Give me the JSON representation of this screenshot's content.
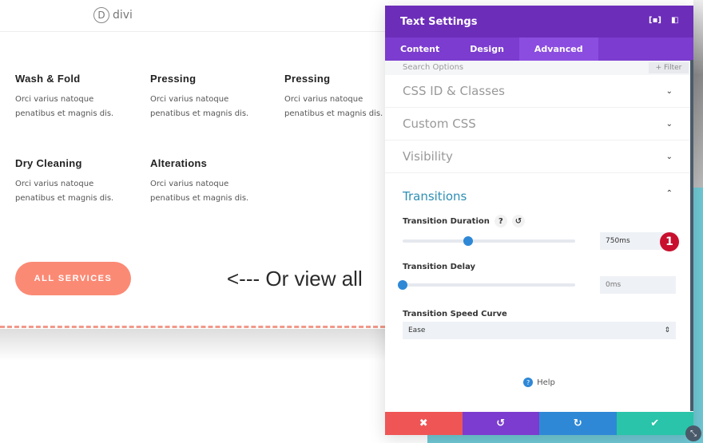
{
  "site": {
    "logo_letter": "D",
    "logo_text": "divi"
  },
  "services": [
    {
      "title": "Wash & Fold",
      "text": "Orci varius natoque penatibus et magnis dis."
    },
    {
      "title": "Pressing",
      "text": "Orci varius natoque penatibus et magnis dis."
    },
    {
      "title": "Pressing",
      "text": "Orci varius natoque penatibus et magnis dis."
    },
    {
      "title": "Dry Cleaning",
      "text": "Orci varius natoque penatibus et magnis dis."
    },
    {
      "title": "Alterations",
      "text": "Orci varius natoque penatibus et magnis dis."
    }
  ],
  "cta": {
    "button": "ALL SERVICES",
    "text": "<--- Or view all"
  },
  "panel": {
    "title": "Text Settings",
    "tabs": [
      "Content",
      "Design",
      "Advanced"
    ],
    "active_tab": "Advanced",
    "search_placeholder": "Search Options",
    "filter_label": "+ Filter",
    "sections": [
      "CSS ID & Classes",
      "Custom CSS",
      "Visibility"
    ],
    "transitions": {
      "title": "Transitions",
      "duration_label": "Transition Duration",
      "duration_value": "750ms",
      "duration_fraction": 0.38,
      "delay_label": "Transition Delay",
      "delay_placeholder": "0ms",
      "delay_fraction": 0,
      "curve_label": "Transition Speed Curve",
      "curve_value": "Ease"
    },
    "help": "Help",
    "badge": "1"
  },
  "colors": {
    "header": "#6c2eb9",
    "tabs": "#7b3ccf",
    "cancel": "#ef5555",
    "undo": "#7b3ccf",
    "redo": "#2e88d6",
    "save": "#29c4a9",
    "accent": "#fb8a75"
  }
}
